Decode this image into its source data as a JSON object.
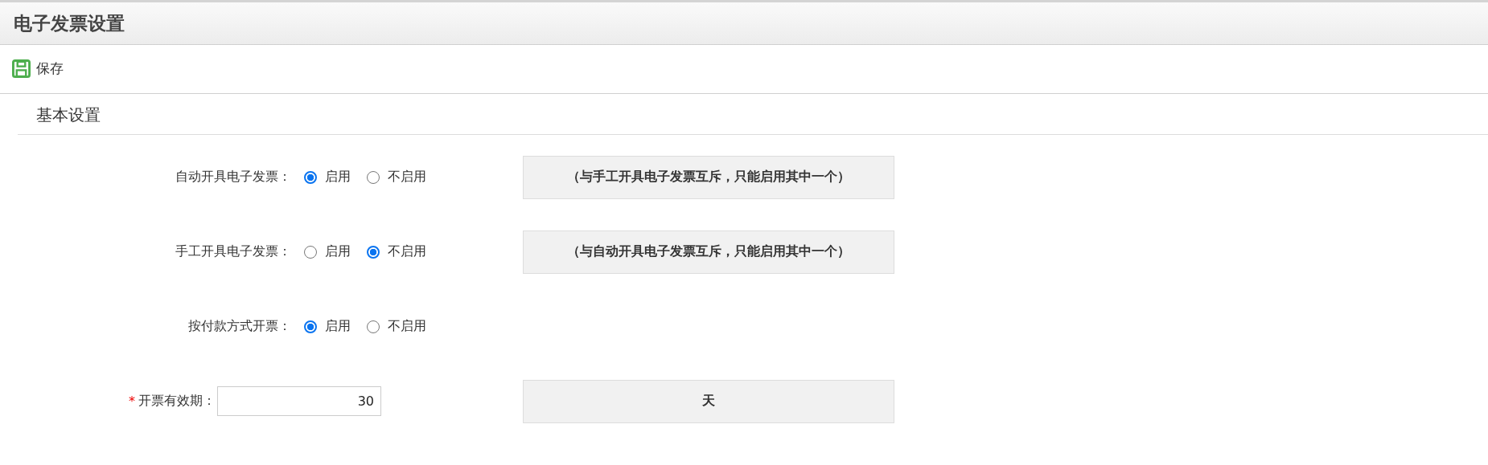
{
  "header": {
    "title": "电子发票设置"
  },
  "toolbar": {
    "save": "保存"
  },
  "section": {
    "title": "基本设置"
  },
  "rows": [
    {
      "kind": "radio",
      "label": "自动开具电子发票：",
      "options": [
        {
          "label": "启用",
          "selected": true
        },
        {
          "label": "不启用",
          "selected": false
        }
      ],
      "note": "（与手工开具电子发票互斥，只能启用其中一个）"
    },
    {
      "kind": "radio",
      "label": "手工开具电子发票：",
      "options": [
        {
          "label": "启用",
          "selected": false
        },
        {
          "label": "不启用",
          "selected": true
        }
      ],
      "note": "（与自动开具电子发票互斥，只能启用其中一个）"
    },
    {
      "kind": "radio",
      "label": "按付款方式开票：",
      "options": [
        {
          "label": "启用",
          "selected": true
        },
        {
          "label": "不启用",
          "selected": false
        }
      ]
    },
    {
      "kind": "input",
      "required": true,
      "required_mark": "*",
      "label": "开票有效期：",
      "value": "30",
      "note": "天"
    }
  ]
}
